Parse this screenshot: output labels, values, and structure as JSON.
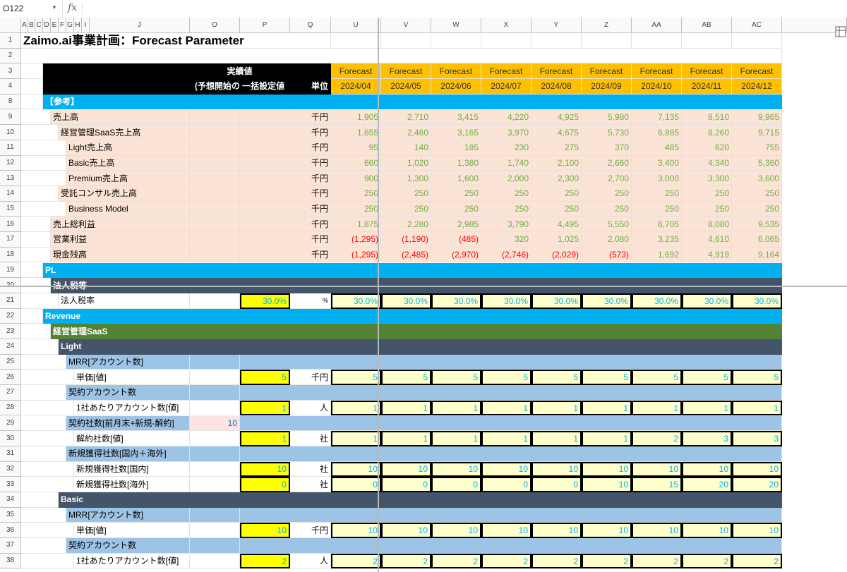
{
  "formula_bar": {
    "cell_ref": "O122",
    "fx_label": "fx",
    "value": ""
  },
  "columns": [
    {
      "label": "A",
      "w": 10
    },
    {
      "label": "B",
      "w": 10
    },
    {
      "label": "C",
      "w": 11
    },
    {
      "label": "D",
      "w": 11
    },
    {
      "label": "E",
      "w": 11
    },
    {
      "label": "F",
      "w": 11
    },
    {
      "label": "G",
      "w": 11
    },
    {
      "label": "H",
      "w": 11
    },
    {
      "label": "I",
      "w": 11
    },
    {
      "label": "J",
      "w": 142
    },
    {
      "label": "O",
      "w": 71
    },
    {
      "label": "P",
      "w": 71
    },
    {
      "label": "Q",
      "w": 58
    },
    {
      "label": "U",
      "w": 71
    },
    {
      "label": "V",
      "w": 71
    },
    {
      "label": "W",
      "w": 71
    },
    {
      "label": "X",
      "w": 71
    },
    {
      "label": "Y",
      "w": 71
    },
    {
      "label": "Z",
      "w": 71
    },
    {
      "label": "AA",
      "w": 71
    },
    {
      "label": "AB",
      "w": 71
    },
    {
      "label": "AC",
      "w": 71
    }
  ],
  "forecast_header": {
    "label": "Forecast",
    "months": [
      "2024/04",
      "2024/05",
      "2024/06",
      "2024/07",
      "2024/08",
      "2024/09",
      "2024/10",
      "2024/11",
      "2024/12"
    ]
  },
  "header_labels": {
    "actual": "実績値",
    "actual_sub": "(予想開始の 一括設定値",
    "unit": "単位"
  },
  "title": "Zaimo.ai事業計画：Forecast Parameter",
  "colors": {
    "header_black": "#000000",
    "forecast_orange": "#ffc000",
    "section_cyan": "#00b0f0",
    "section_dark": "#44546a",
    "section_green": "#548235",
    "sub_blue": "#9dc3e6",
    "ref_salmon": "#fbe4d5",
    "input_yellow": "#ffff00",
    "forecast_input": "#ffffcc",
    "value_green": "#70ad47",
    "value_red": "#ff0000",
    "value_blue": "#00b0f0"
  },
  "rows": [
    {
      "num": "1",
      "kind": "title"
    },
    {
      "num": "2",
      "kind": "blank"
    },
    {
      "num": "3",
      "kind": "hdr3"
    },
    {
      "num": "4",
      "kind": "hdr4"
    },
    {
      "num": "8",
      "kind": "section",
      "label": "【参考】",
      "indent": 0,
      "color": "#00b0f0"
    },
    {
      "num": "9",
      "kind": "ref",
      "label": "売上高",
      "indent": 1,
      "unit": "千円",
      "values": [
        "1,905",
        "2,710",
        "3,415",
        "4,220",
        "4,925",
        "5,980",
        "7,135",
        "8,510",
        "9,965"
      ]
    },
    {
      "num": "10",
      "kind": "ref",
      "label": "経営管理SaaS売上高",
      "indent": 2,
      "unit": "千円",
      "values": [
        "1,655",
        "2,460",
        "3,165",
        "3,970",
        "4,675",
        "5,730",
        "6,885",
        "8,260",
        "9,715"
      ]
    },
    {
      "num": "11",
      "kind": "ref",
      "label": "Light売上高",
      "indent": 3,
      "unit": "千円",
      "values": [
        "95",
        "140",
        "185",
        "230",
        "275",
        "370",
        "485",
        "620",
        "755"
      ]
    },
    {
      "num": "12",
      "kind": "ref",
      "label": "Basic売上高",
      "indent": 3,
      "unit": "千円",
      "values": [
        "660",
        "1,020",
        "1,380",
        "1,740",
        "2,100",
        "2,660",
        "3,400",
        "4,340",
        "5,360"
      ]
    },
    {
      "num": "13",
      "kind": "ref",
      "label": "Premium売上高",
      "indent": 3,
      "unit": "千円",
      "values": [
        "900",
        "1,300",
        "1,600",
        "2,000",
        "2,300",
        "2,700",
        "3,000",
        "3,300",
        "3,600"
      ]
    },
    {
      "num": "14",
      "kind": "ref",
      "label": "受託コンサル売上高",
      "indent": 2,
      "unit": "千円",
      "values": [
        "250",
        "250",
        "250",
        "250",
        "250",
        "250",
        "250",
        "250",
        "250"
      ]
    },
    {
      "num": "15",
      "kind": "ref",
      "label": "Business Model",
      "indent": 3,
      "unit": "千円",
      "values": [
        "250",
        "250",
        "250",
        "250",
        "250",
        "250",
        "250",
        "250",
        "250"
      ]
    },
    {
      "num": "16",
      "kind": "ref",
      "label": "売上総利益",
      "indent": 1,
      "unit": "千円",
      "values": [
        "1,875",
        "2,280",
        "2,985",
        "3,790",
        "4,495",
        "5,550",
        "6,705",
        "8,080",
        "9,535"
      ]
    },
    {
      "num": "17",
      "kind": "ref",
      "label": "営業利益",
      "indent": 1,
      "unit": "千円",
      "values": [
        "(1,295)",
        "(1,190)",
        "(485)",
        "320",
        "1,025",
        "2,080",
        "3,235",
        "4,610",
        "6,065"
      ]
    },
    {
      "num": "18",
      "kind": "ref",
      "label": "現金残高",
      "indent": 1,
      "unit": "千円",
      "values": [
        "(1,295)",
        "(2,485)",
        "(2,970)",
        "(2,746)",
        "(2,029)",
        "(573)",
        "1,692",
        "4,919",
        "9,164"
      ]
    },
    {
      "num": "19",
      "kind": "section",
      "label": "PL",
      "indent": 0,
      "color": "#00b0f0"
    },
    {
      "num": "20",
      "kind": "section",
      "label": "法人税等",
      "indent": 1,
      "color": "#44546a"
    },
    {
      "num": "21",
      "kind": "input",
      "label": "法人税率",
      "indent": 2,
      "p": "30.0%",
      "unit": "%",
      "values": [
        "30.0%",
        "30.0%",
        "30.0%",
        "30.0%",
        "30.0%",
        "30.0%",
        "30.0%",
        "30.0%",
        "30.0%"
      ]
    },
    {
      "num": "22",
      "kind": "section",
      "label": "Revenue",
      "indent": 0,
      "color": "#00b0f0"
    },
    {
      "num": "23",
      "kind": "section",
      "label": "経営管理SaaS",
      "indent": 1,
      "color": "#548235"
    },
    {
      "num": "24",
      "kind": "section",
      "label": "Light",
      "indent": 2,
      "color": "#44546a"
    },
    {
      "num": "25",
      "kind": "sub",
      "label": "MRR[アカウント数]",
      "indent": 3
    },
    {
      "num": "26",
      "kind": "input",
      "label": "単価[値]",
      "indent": 4,
      "p": "5",
      "unit": "千円",
      "values": [
        "5",
        "5",
        "5",
        "5",
        "5",
        "5",
        "5",
        "5",
        "5"
      ]
    },
    {
      "num": "27",
      "kind": "sub",
      "label": "契約アカウント数",
      "indent": 3
    },
    {
      "num": "28",
      "kind": "input",
      "label": "1社あたりアカウント数[値]",
      "indent": 4,
      "p": "1",
      "unit": "人",
      "values": [
        "1",
        "1",
        "1",
        "1",
        "1",
        "1",
        "1",
        "1",
        "1"
      ]
    },
    {
      "num": "29",
      "kind": "sub",
      "label": "契約社数[前月末+新規-解約]",
      "indent": 3,
      "o": "10"
    },
    {
      "num": "30",
      "kind": "input",
      "label": "解約社数[値]",
      "indent": 4,
      "p": "1",
      "unit": "社",
      "values": [
        "1",
        "1",
        "1",
        "1",
        "1",
        "1",
        "2",
        "3",
        "3"
      ]
    },
    {
      "num": "31",
      "kind": "sub",
      "label": "新規獲得社数[国内＋海外]",
      "indent": 3
    },
    {
      "num": "32",
      "kind": "input",
      "label": "新規獲得社数[国内]",
      "indent": 4,
      "p": "10",
      "unit": "社",
      "values": [
        "10",
        "10",
        "10",
        "10",
        "10",
        "10",
        "10",
        "10",
        "10"
      ]
    },
    {
      "num": "33",
      "kind": "input",
      "label": "新規獲得社数[海外]",
      "indent": 4,
      "p": "0",
      "unit": "社",
      "values": [
        "0",
        "0",
        "0",
        "0",
        "0",
        "10",
        "15",
        "20",
        "20"
      ]
    },
    {
      "num": "34",
      "kind": "section",
      "label": "Basic",
      "indent": 2,
      "color": "#44546a"
    },
    {
      "num": "35",
      "kind": "sub",
      "label": "MRR[アカウント数]",
      "indent": 3
    },
    {
      "num": "36",
      "kind": "input",
      "label": "単価[値]",
      "indent": 4,
      "p": "10",
      "unit": "千円",
      "values": [
        "10",
        "10",
        "10",
        "10",
        "10",
        "10",
        "10",
        "10",
        "10"
      ]
    },
    {
      "num": "37",
      "kind": "sub",
      "label": "契約アカウント数",
      "indent": 3
    },
    {
      "num": "38",
      "kind": "input",
      "label": "1社あたりアカウント数[値]",
      "indent": 4,
      "p": "2",
      "unit": "人",
      "values": [
        "2",
        "2",
        "2",
        "2",
        "2",
        "2",
        "2",
        "2",
        "2"
      ]
    }
  ]
}
